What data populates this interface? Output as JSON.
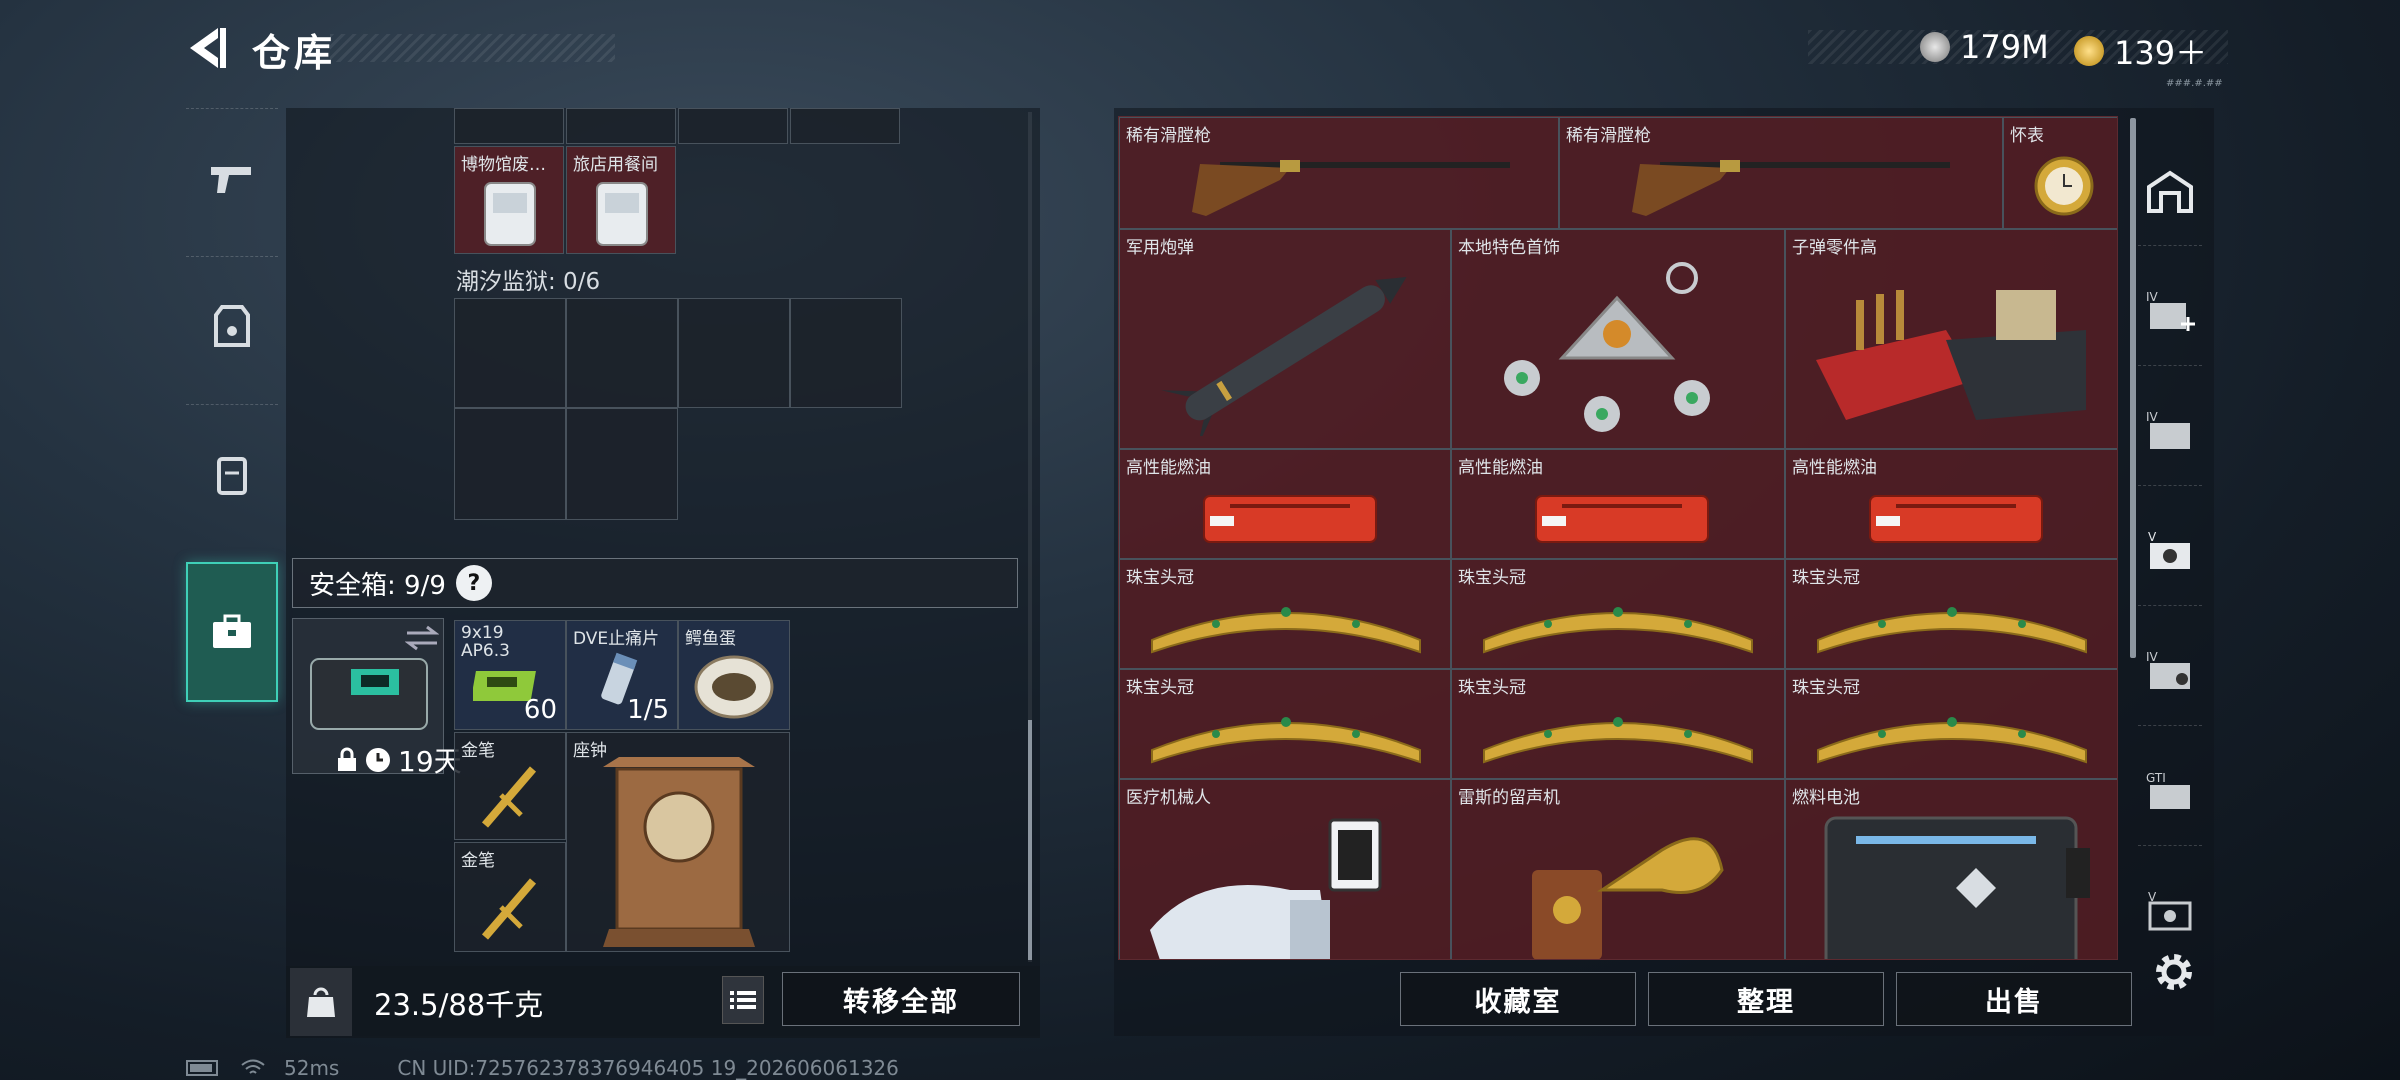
{
  "header": {
    "title": "仓库",
    "currency1": "179M",
    "currency2": "139＋",
    "tiny_text": "###.#.##"
  },
  "left_panel": {
    "row_top": [
      {
        "name": "博物馆废…",
        "bg": "red"
      },
      {
        "name": "旅店用餐间",
        "bg": "red"
      }
    ],
    "tide_prison": "潮汐监狱: 0/6",
    "safe_label": "安全箱: 9/9",
    "safe_help": "?",
    "safe_days": "19天",
    "items": [
      {
        "name": "9x19 AP6.3",
        "qty": "60",
        "bg": "blue"
      },
      {
        "name": "DVE止痛片",
        "qty": "1/5",
        "bg": "blue"
      },
      {
        "name": "鳄鱼蛋",
        "qty": "",
        "bg": "blue"
      },
      {
        "name": "金笔",
        "qty": ""
      },
      {
        "name": "座钟",
        "qty": ""
      },
      {
        "name": "金笔",
        "qty": ""
      }
    ],
    "weight": "23.5/88千克",
    "transfer_all": "转移全部"
  },
  "right_panel": {
    "items": [
      {
        "name": "稀有滑膛枪",
        "bg": "red"
      },
      {
        "name": "稀有滑膛枪",
        "bg": "red"
      },
      {
        "name": "怀表",
        "bg": "red"
      },
      {
        "name": "军用炮弹",
        "bg": "red"
      },
      {
        "name": "本地特色首饰",
        "bg": "red"
      },
      {
        "name": "子弹零件高",
        "bg": "red"
      },
      {
        "name": "高性能燃油",
        "bg": "red"
      },
      {
        "name": "高性能燃油",
        "bg": "red"
      },
      {
        "name": "高性能燃油",
        "bg": "red"
      },
      {
        "name": "珠宝头冠",
        "bg": "red"
      },
      {
        "name": "珠宝头冠",
        "bg": "red"
      },
      {
        "name": "珠宝头冠",
        "bg": "red"
      },
      {
        "name": "珠宝头冠",
        "bg": "red"
      },
      {
        "name": "珠宝头冠",
        "bg": "red"
      },
      {
        "name": "珠宝头冠",
        "bg": "red"
      },
      {
        "name": "医疗机械人",
        "bg": "red"
      },
      {
        "name": "雷斯的留声机",
        "bg": "red"
      },
      {
        "name": "燃料电池",
        "bg": "red"
      }
    ],
    "buttons": {
      "collection": "收藏室",
      "organize": "整理",
      "sell": "出售"
    }
  },
  "status": {
    "ping": "52ms",
    "uid": "CN UID:725762378376946405 19_202606061326"
  },
  "colors": {
    "accent": "#3fd0b8",
    "red_cell": "#5a1e24",
    "gold": "#d4a93a"
  }
}
